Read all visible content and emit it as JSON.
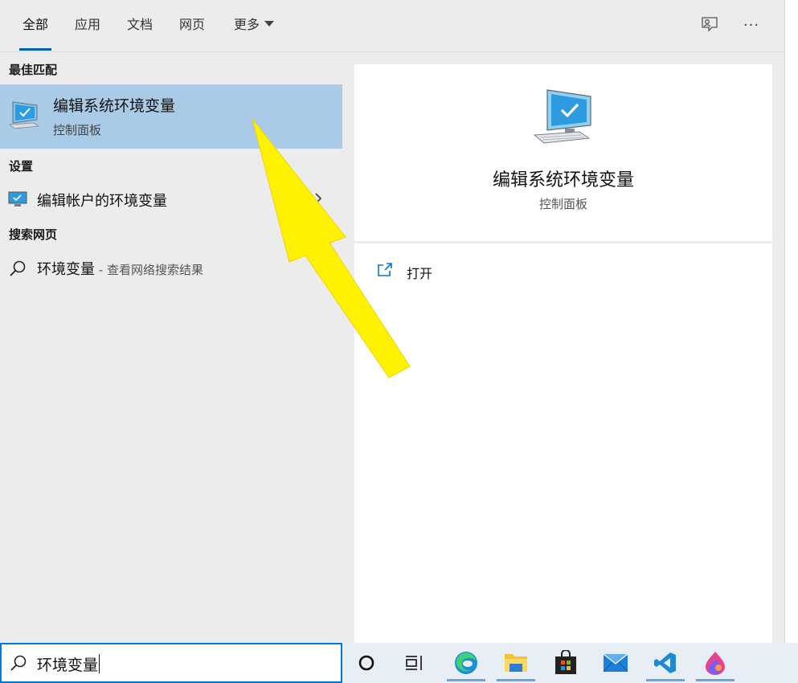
{
  "tabs": [
    {
      "label": "全部",
      "active": true
    },
    {
      "label": "应用",
      "active": false
    },
    {
      "label": "文档",
      "active": false
    },
    {
      "label": "网页",
      "active": false
    },
    {
      "label": "更多",
      "active": false,
      "dropdown": true
    }
  ],
  "header_icons": [
    "feedback-icon",
    "more-options-icon"
  ],
  "more_options_label": "···",
  "best_match": {
    "header": "最佳匹配",
    "title": "编辑系统环境变量",
    "subtitle": "控制面板",
    "icon": "computer-monitor-icon"
  },
  "settings": {
    "header": "设置",
    "item_label": "编辑帐户的环境变量",
    "icon": "monitor-settings-icon"
  },
  "web_search": {
    "header": "搜索网页",
    "query": "环境变量",
    "suffix": " - 查看网络搜索结果",
    "icon": "search-icon"
  },
  "preview": {
    "title": "编辑系统环境变量",
    "subtitle": "控制面板",
    "icon": "computer-monitor-icon"
  },
  "actions": [
    {
      "label": "打开",
      "icon": "open-external-icon"
    }
  ],
  "search_box": {
    "value": "环境变量",
    "icon": "search-icon"
  },
  "taskbar_items": [
    "cortana-icon",
    "task-view-icon",
    "edge-icon",
    "file-explorer-icon",
    "store-icon",
    "mail-icon",
    "vscode-icon",
    "paint-app-icon"
  ],
  "colors": {
    "accent": "#0078d7",
    "selected_row": "#a9cbe8",
    "panel_bg": "#ececec",
    "annotation_arrow": "#fff200"
  }
}
